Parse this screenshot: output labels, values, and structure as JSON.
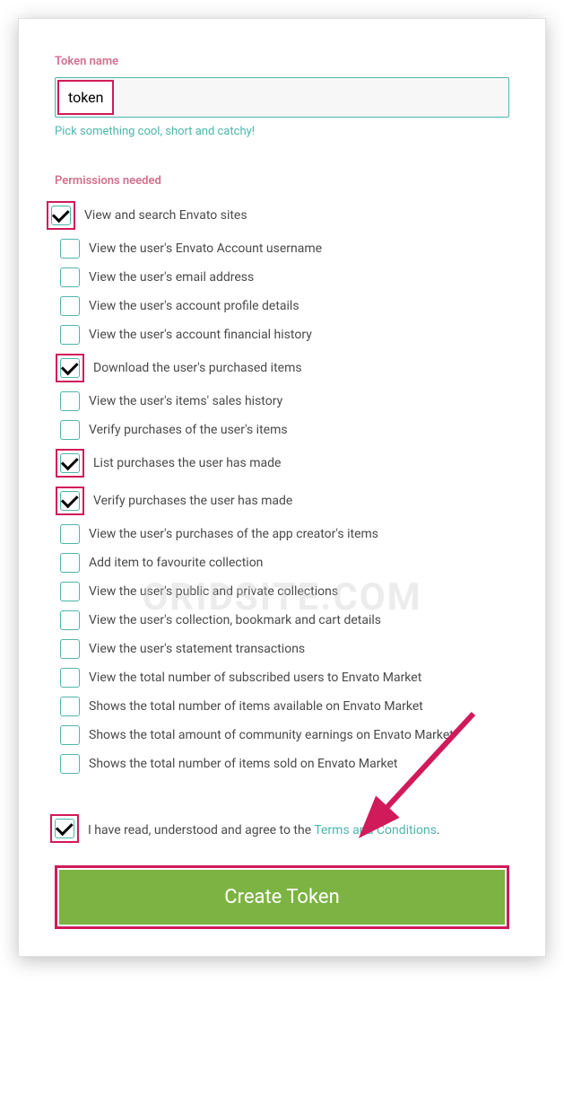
{
  "token_name": {
    "label": "Token name",
    "value": "token",
    "hint": "Pick something cool, short and catchy!"
  },
  "permissions": {
    "label": "Permissions needed",
    "items": [
      {
        "label": "View and search Envato sites",
        "checked": true,
        "highlighted": true
      },
      {
        "label": "View the user's Envato Account username",
        "checked": false,
        "highlighted": false
      },
      {
        "label": "View the user's email address",
        "checked": false,
        "highlighted": false
      },
      {
        "label": "View the user's account profile details",
        "checked": false,
        "highlighted": false
      },
      {
        "label": "View the user's account financial history",
        "checked": false,
        "highlighted": false
      },
      {
        "label": "Download the user's purchased items",
        "checked": true,
        "highlighted": true
      },
      {
        "label": "View the user's items' sales history",
        "checked": false,
        "highlighted": false
      },
      {
        "label": "Verify purchases of the user's items",
        "checked": false,
        "highlighted": false
      },
      {
        "label": "List purchases the user has made",
        "checked": true,
        "highlighted": true
      },
      {
        "label": "Verify purchases the user has made",
        "checked": true,
        "highlighted": true
      },
      {
        "label": "View the user's purchases of the app creator's items",
        "checked": false,
        "highlighted": false
      },
      {
        "label": "Add item to favourite collection",
        "checked": false,
        "highlighted": false
      },
      {
        "label": "View the user's public and private collections",
        "checked": false,
        "highlighted": false
      },
      {
        "label": "View the user's collection, bookmark and cart details",
        "checked": false,
        "highlighted": false
      },
      {
        "label": "View the user's statement transactions",
        "checked": false,
        "highlighted": false
      },
      {
        "label": "View the total number of subscribed users to Envato Market",
        "checked": false,
        "highlighted": false
      },
      {
        "label": "Shows the total number of items available on Envato Market",
        "checked": false,
        "highlighted": false
      },
      {
        "label": "Shows the total amount of community earnings on Envato Market",
        "checked": false,
        "highlighted": false
      },
      {
        "label": "Shows the total number of items sold on Envato Market",
        "checked": false,
        "highlighted": false
      }
    ]
  },
  "terms": {
    "checked": true,
    "text_prefix": "I have read, understood and agree to the ",
    "link_text": "Terms and Conditions",
    "text_suffix": "."
  },
  "create_button": "Create Token",
  "watermark": "ORIDSITE.COM"
}
